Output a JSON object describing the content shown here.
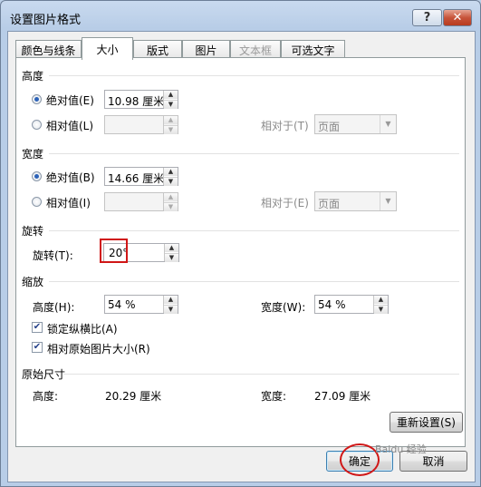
{
  "window": {
    "title": "设置图片格式",
    "help_label": "?",
    "close_label": "✕"
  },
  "tabs": [
    {
      "label": "颜色与线条",
      "state": "normal"
    },
    {
      "label": "大小",
      "state": "active"
    },
    {
      "label": "版式",
      "state": "normal"
    },
    {
      "label": "图片",
      "state": "normal"
    },
    {
      "label": "文本框",
      "state": "disabled"
    },
    {
      "label": "可选文字",
      "state": "normal"
    }
  ],
  "height_section": {
    "title": "高度",
    "absolute_label": "绝对值(E)",
    "absolute_value": "10.98 厘米",
    "absolute_selected": true,
    "relative_label": "相对值(L)",
    "relative_value": "",
    "relative_to_label": "相对于(T)",
    "relative_to_value": "页面"
  },
  "width_section": {
    "title": "宽度",
    "absolute_label": "绝对值(B)",
    "absolute_value": "14.66 厘米",
    "absolute_selected": true,
    "relative_label": "相对值(I)",
    "relative_value": "",
    "relative_to_label": "相对于(E)",
    "relative_to_value": "页面"
  },
  "rotation_section": {
    "title": "旋转",
    "rotation_label": "旋转(T):",
    "rotation_value": "20°"
  },
  "scale_section": {
    "title": "缩放",
    "height_label": "高度(H):",
    "height_value": "54 %",
    "width_label": "宽度(W):",
    "width_value": "54 %",
    "lock_aspect_label": "锁定纵横比(A)",
    "lock_aspect_checked": true,
    "relative_original_label": "相对原始图片大小(R)",
    "relative_original_checked": true
  },
  "original_size_section": {
    "title": "原始尺寸",
    "height_label": "高度:",
    "height_value": "20.29 厘米",
    "width_label": "宽度:",
    "width_value": "27.09 厘米"
  },
  "buttons": {
    "reset_label": "重新设置(S)",
    "ok_label": "确定",
    "cancel_label": "取消"
  },
  "glyphs": {
    "up": "▲",
    "down": "▼",
    "drop": "▼",
    "check": "✔"
  },
  "watermark": "Baidu 经验",
  "colors": {
    "highlight": "#d01616",
    "radio_dot": "#2c62b8",
    "title_bar": "#b8cde7",
    "close_button": "#c7543a"
  }
}
